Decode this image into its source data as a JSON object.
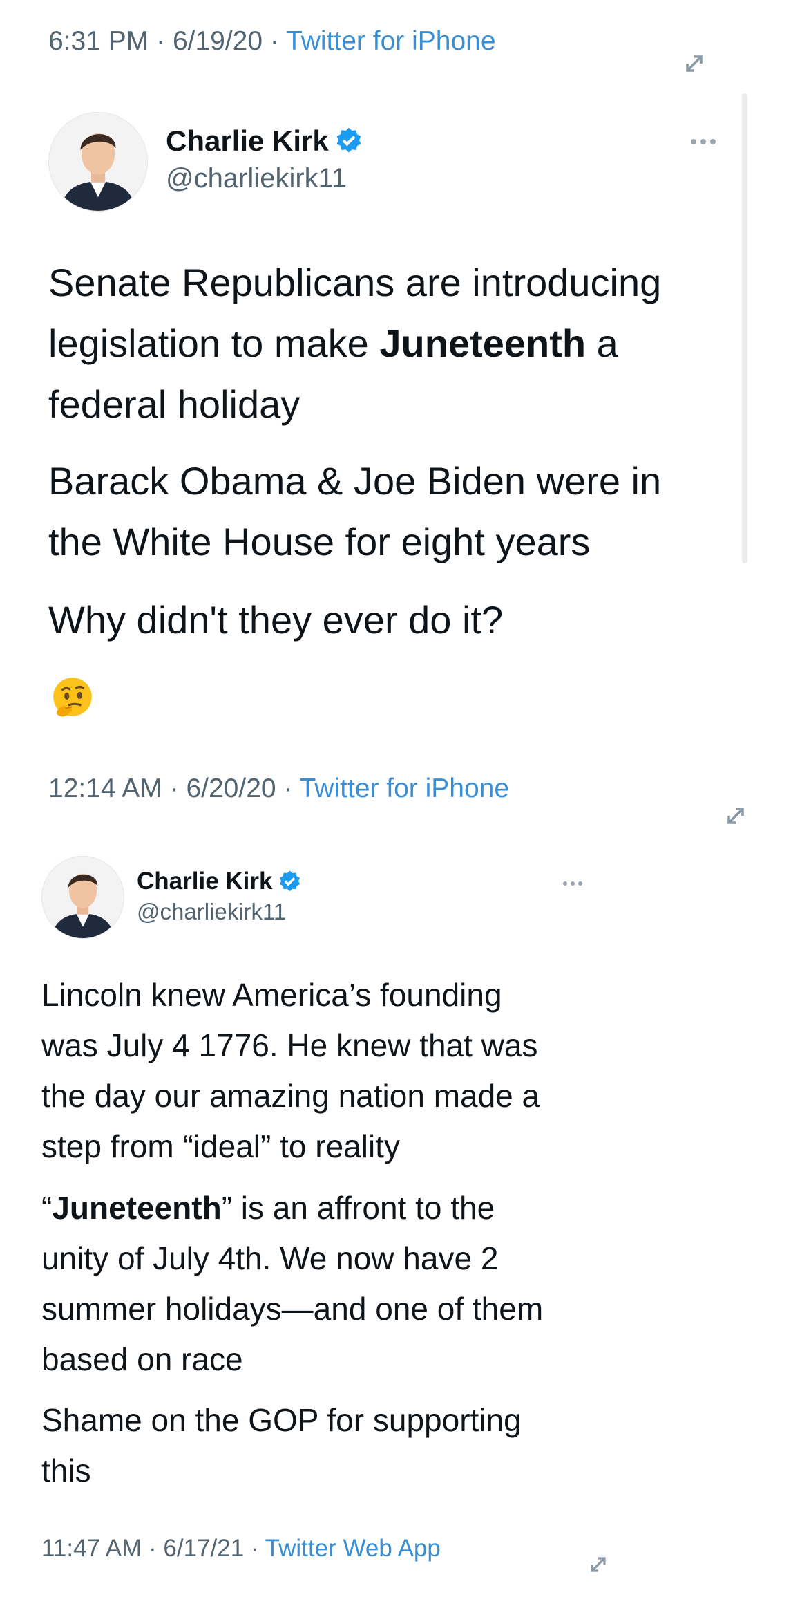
{
  "tweet1": {
    "header_meta": {
      "time": "6:31 PM",
      "date": "6/19/20",
      "source": "Twitter for iPhone"
    },
    "author": {
      "name": "Charlie Kirk",
      "handle": "@charliekirk11"
    },
    "paragraphs": [
      {
        "lines": [
          {
            "text": "Senate Republicans are introducing"
          },
          {
            "pre": "legislation to make ",
            "bold": "Juneteenth",
            "post": " a"
          },
          {
            "text": "federal holiday"
          }
        ]
      },
      {
        "lines": [
          {
            "text": "Barack Obama & Joe Biden were in"
          },
          {
            "text": "the White House for eight years"
          }
        ]
      },
      {
        "lines": [
          {
            "text": "Why didn't they ever do it?"
          }
        ]
      }
    ],
    "emoji": "thinking-face-emoji",
    "footer_meta": {
      "time": "12:14 AM",
      "date": "6/20/20",
      "source": "Twitter for iPhone"
    }
  },
  "tweet2": {
    "author": {
      "name": "Charlie Kirk",
      "handle": "@charliekirk11"
    },
    "paragraphs": [
      {
        "lines": [
          {
            "text": "Lincoln knew America’s founding"
          },
          {
            "text": "was July 4 1776. He knew that was"
          },
          {
            "text": "the day our amazing nation made a"
          },
          {
            "text": "step from “ideal” to reality"
          }
        ]
      },
      {
        "lines": [
          {
            "pre": "“",
            "bold": "Juneteenth",
            "post": "” is an affront to the"
          },
          {
            "text": "unity of July 4th. We now have 2"
          },
          {
            "text": "summer holidays—and one of them"
          },
          {
            "text": "based on race"
          }
        ]
      },
      {
        "lines": [
          {
            "text": "Shame on the GOP for supporting"
          },
          {
            "text": "this"
          }
        ]
      }
    ],
    "footer_meta": {
      "time": "11:47 AM",
      "date": "6/17/21",
      "source": "Twitter Web App"
    }
  },
  "separator": "·",
  "icons": {
    "expand": "expand-arrows-icon",
    "more": "more-options-icon",
    "verified": "verified-badge-icon"
  },
  "colors": {
    "meta_text": "#536471",
    "source_link": "#3a8fd4",
    "verified_blue": "#1d9bf0"
  }
}
